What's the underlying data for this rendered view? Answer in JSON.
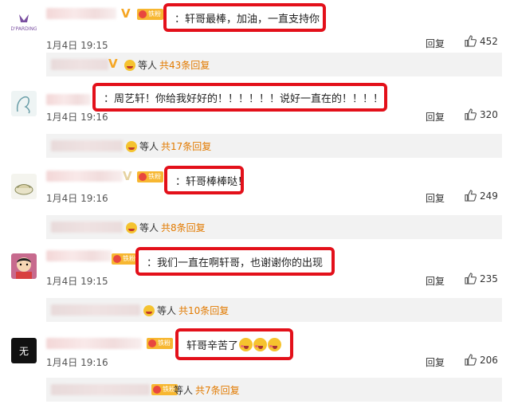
{
  "reply_label": "回复",
  "equals_label": "等人",
  "comments": [
    {
      "avatar": "avatar-logo",
      "text": "：轩哥最棒，加油，一直支持你",
      "date": "1月4日 19:15",
      "likes": "452",
      "sub_count": "共43条回复"
    },
    {
      "avatar": "avatar-sketch",
      "text": "：周艺轩！你给我好好的！！！！！！说好一直在的！！！！",
      "date": "1月4日 19:16",
      "likes": "320",
      "sub_count": "共17条回复"
    },
    {
      "avatar": "avatar-food",
      "text": "：轩哥棒棒哒！",
      "date": "1月4日 19:16",
      "likes": "249",
      "sub_count": "共8条回复"
    },
    {
      "avatar": "avatar-cartoon",
      "text": "：我们一直在啊轩哥，也谢谢你的出现",
      "date": "1月4日 19:15",
      "likes": "235",
      "sub_count": "共10条回复"
    },
    {
      "avatar": "avatar-dark",
      "avatar_text": "无",
      "text": "轩哥辛苦了",
      "date": "1月4日 19:16",
      "likes": "206",
      "sub_count": "共7条回复"
    }
  ],
  "colors": {
    "highlight_border": "#e3101a",
    "count": "#e27a00",
    "subreply_bg": "#f2f2f2"
  }
}
